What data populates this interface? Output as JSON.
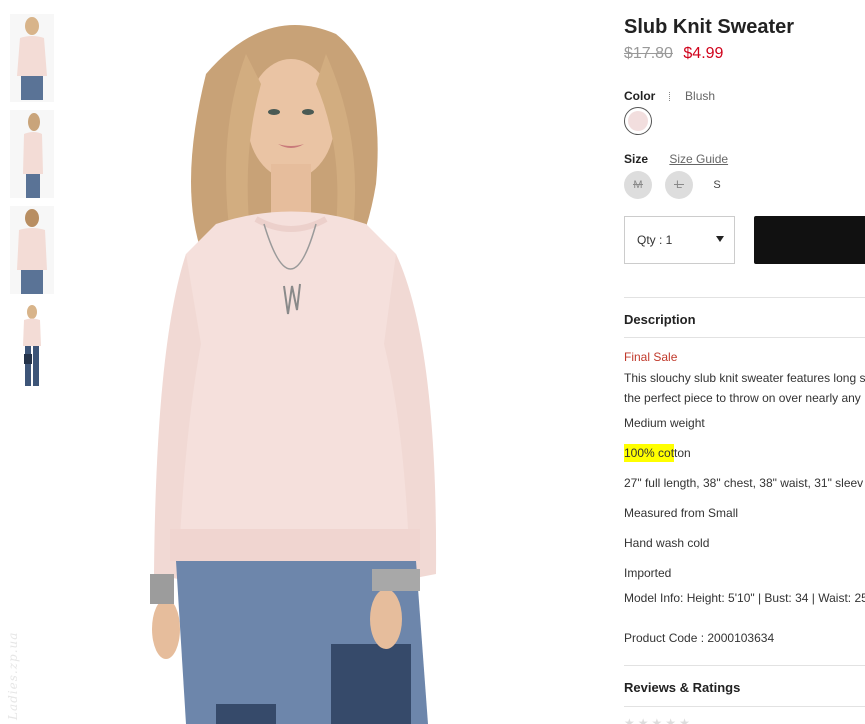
{
  "product": {
    "title": "Slub Knit Sweater",
    "old_price": "$17.80",
    "sale_price": "$4.99"
  },
  "color": {
    "label": "Color",
    "value_icon": "dotted-swatch-icon",
    "value": "Blush",
    "swatch_color": "#f2dede"
  },
  "size": {
    "label": "Size",
    "guide_label": "Size Guide",
    "options": [
      {
        "label": "M",
        "available": false
      },
      {
        "label": "L",
        "available": false
      },
      {
        "label": "S",
        "available": true
      }
    ]
  },
  "quantity": {
    "label": "Qty : 1"
  },
  "description": {
    "title": "Description",
    "final_sale": "Final Sale",
    "intro_line1": "This slouchy slub knit sweater features long s",
    "intro_line2": "the perfect piece to throw on over nearly any",
    "details": [
      "Medium weight",
      "100% cotton",
      "27\" full length, 38\" chest, 38\" waist, 31\" sleev",
      "Measured from Small",
      "Hand wash cold",
      "Imported",
      "Model Info: Height: 5'10\" | Bust: 34 | Waist: 25"
    ],
    "highlight_part": "100% cot",
    "highlight_rest": "ton",
    "product_code": "Product Code : 2000103634"
  },
  "reviews": {
    "title": "Reviews & Ratings"
  },
  "watermark": "Ladies.zp.ua",
  "colors": {
    "sale_red": "#d0021b",
    "final_sale_red": "#c0392b",
    "highlight": "#ffff00",
    "button_black": "#111111"
  }
}
